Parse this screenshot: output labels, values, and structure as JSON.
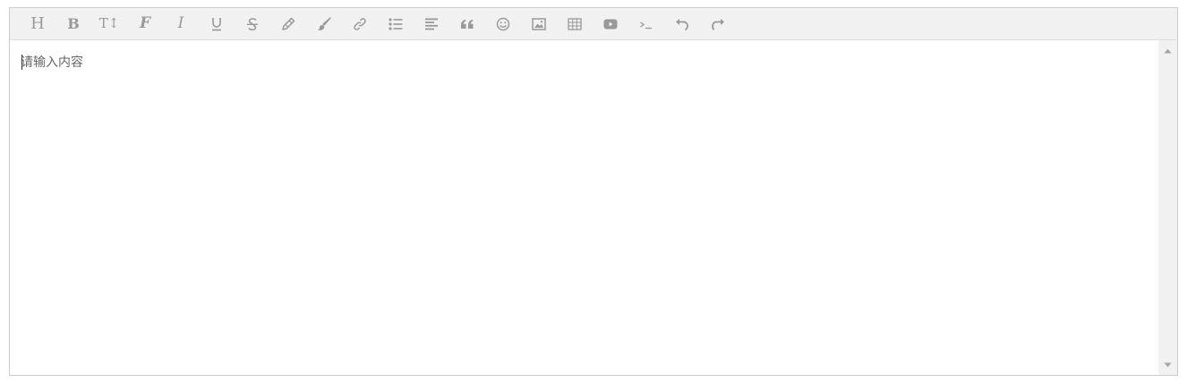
{
  "toolbar": {
    "heading_label": "H",
    "bold_label": "B",
    "font_size_label": "T↕",
    "font_family_label": "F",
    "italic_label": "I",
    "icons": [
      "heading-icon",
      "bold-icon",
      "font-size-icon",
      "font-family-icon",
      "italic-icon",
      "underline-icon",
      "strikethrough-icon",
      "highlight-pen-icon",
      "brush-icon",
      "link-icon",
      "bullet-list-icon",
      "align-icon",
      "quote-icon",
      "emoji-icon",
      "image-icon",
      "table-icon",
      "video-icon",
      "code-icon",
      "undo-icon",
      "redo-icon"
    ]
  },
  "editor": {
    "placeholder": "请输入内容",
    "value": ""
  },
  "colors": {
    "toolbar_bg": "#f1f1f1",
    "icon": "#999999",
    "border": "#cccccc",
    "scrollbar_bg": "#f1f1f1"
  }
}
